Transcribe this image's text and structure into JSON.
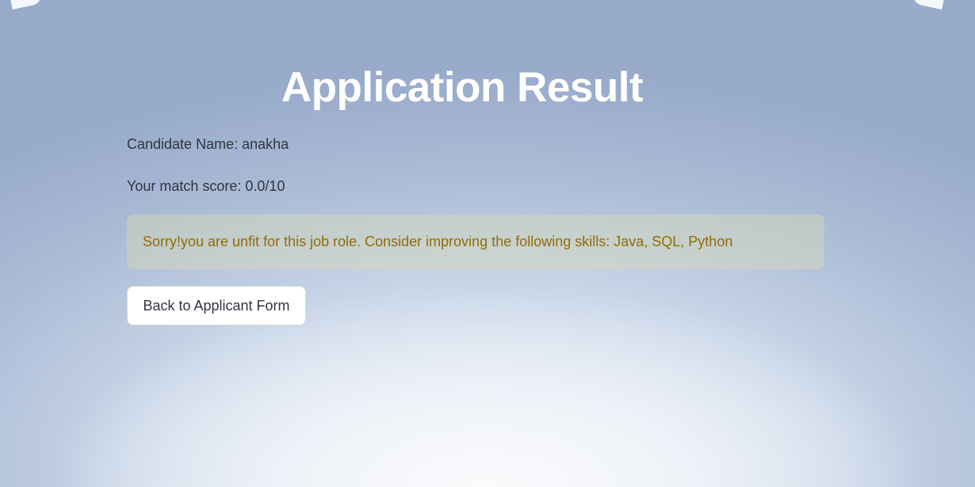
{
  "page": {
    "title": "Application Result"
  },
  "result": {
    "candidate_line": "Candidate Name: anakha",
    "score_line": "Your match score: 0.0/10",
    "warning_message": "Sorry!you are unfit for this job role. Consider improving the following skills: Java, SQL, Python"
  },
  "actions": {
    "back_label": "Back to Applicant Form"
  },
  "colors": {
    "title": "#ffffff",
    "body_text": "#31333f",
    "warning_text": "#926c05",
    "warning_bg": "#d6dab6"
  }
}
